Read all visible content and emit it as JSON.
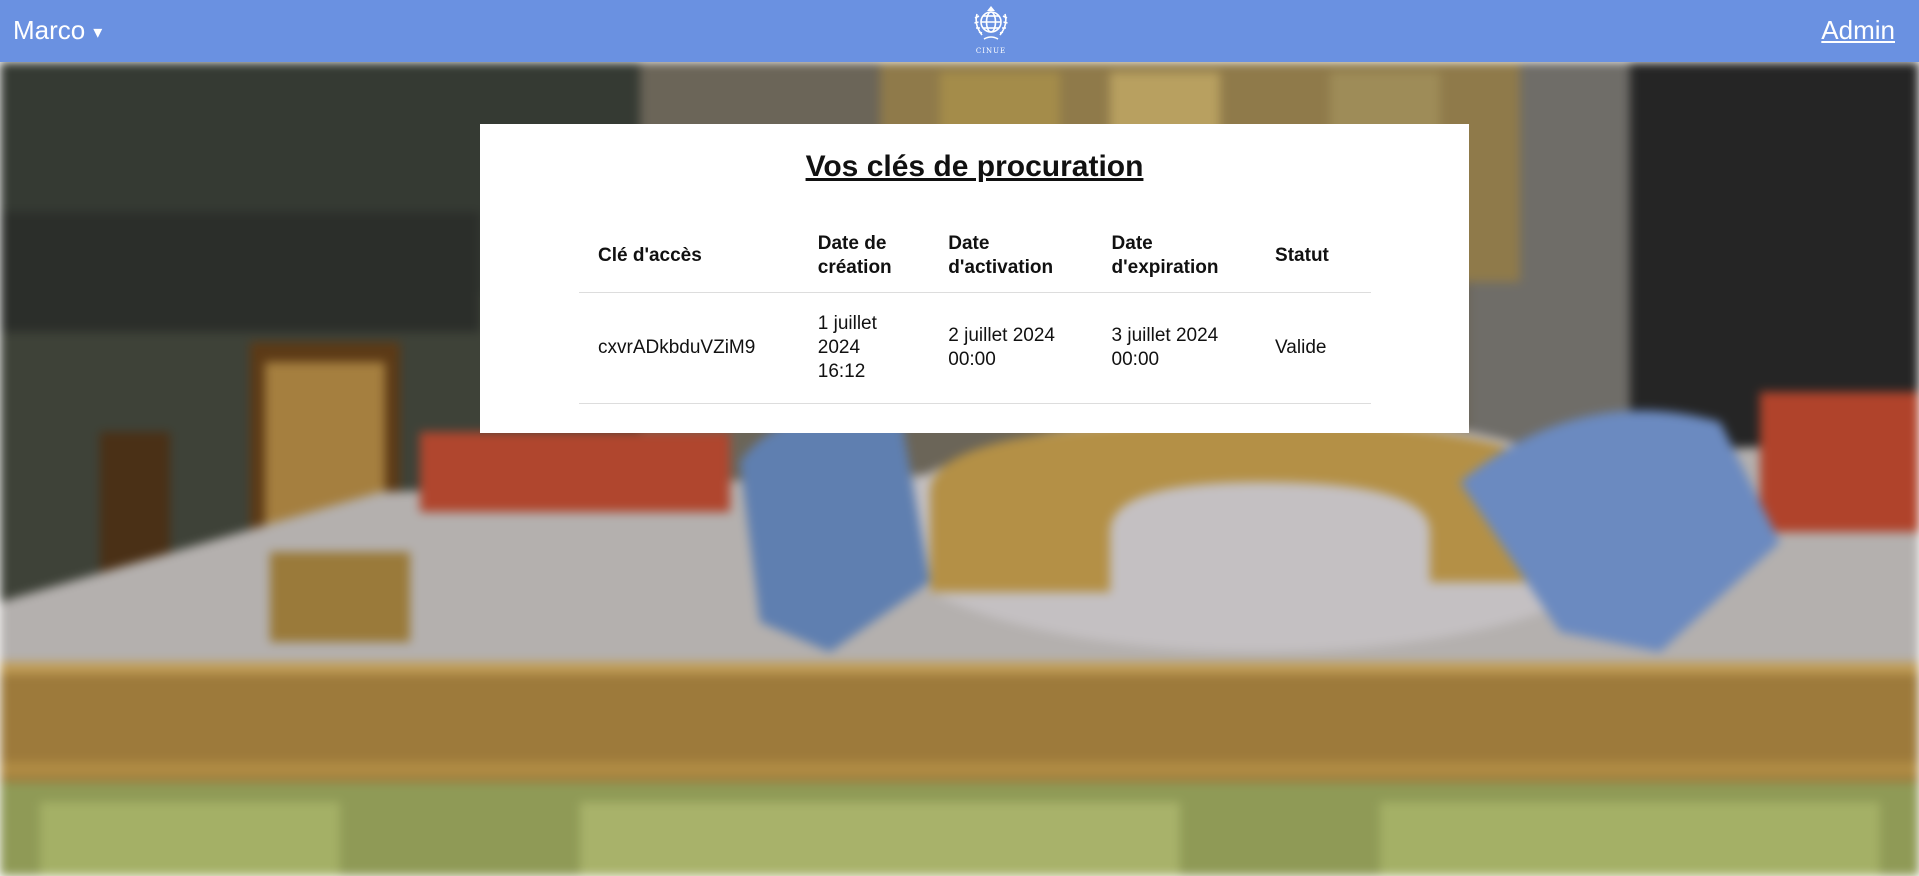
{
  "nav": {
    "user_label": "Marco",
    "caret": "▾",
    "admin_label": "Admin",
    "logo_text": "CINUE",
    "background_color": "#6a91e1"
  },
  "card": {
    "title": "Vos clés de procuration",
    "columns": [
      "Clé d'accès",
      "Date de création",
      "Date d'activation",
      "Date d'expiration",
      "Statut"
    ],
    "rows": [
      {
        "key": "cxvrADkbduVZiM9",
        "created": "1 juillet 2024 16:12",
        "activation": "2 juillet 2024 00:00",
        "expiration": "3 juillet 2024 00:00",
        "status": "Valide"
      }
    ]
  }
}
